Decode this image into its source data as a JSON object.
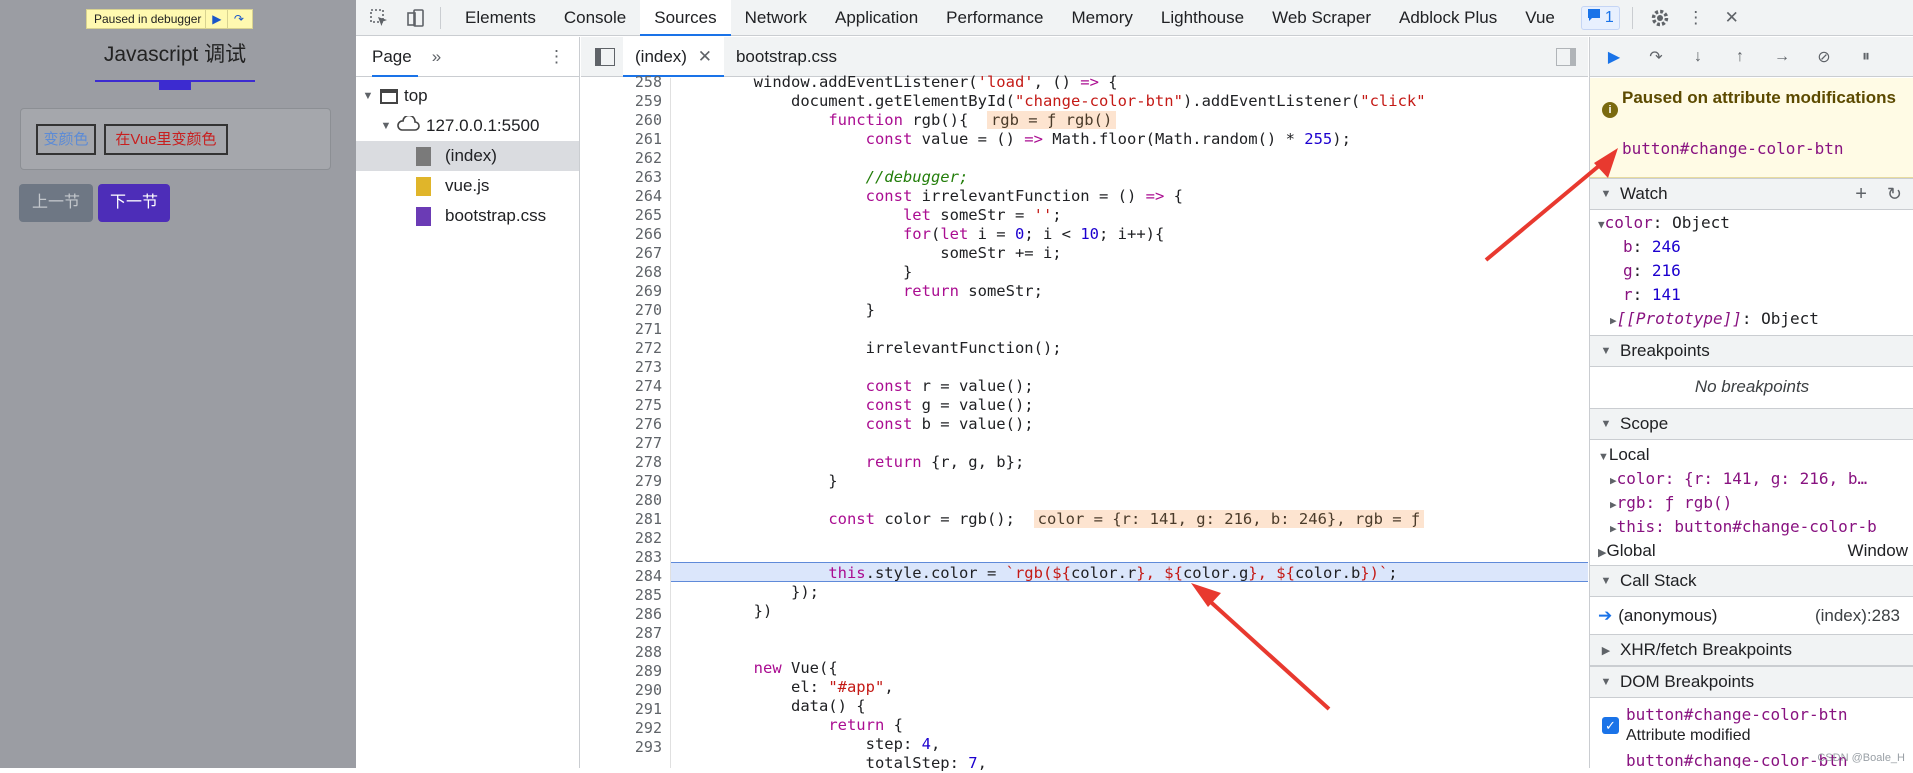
{
  "page": {
    "paused_label": "Paused in debugger",
    "title": "Javascript 调试",
    "btn_change_color": "变颜色",
    "btn_vue_change_color": "在Vue里变颜色",
    "prev_label": "上一节",
    "next_label": "下一节"
  },
  "toolbar": {
    "tabs": [
      "Elements",
      "Console",
      "Sources",
      "Network",
      "Application",
      "Performance",
      "Memory",
      "Lighthouse",
      "Web Scraper",
      "Adblock Plus",
      "Vue"
    ],
    "active_tab": "Sources",
    "issues_count": "1"
  },
  "navigator": {
    "tab": "Page",
    "top": "top",
    "host": "127.0.0.1:5500",
    "files": [
      "(index)",
      "vue.js",
      "bootstrap.css"
    ],
    "file_colors": [
      "#7a7a7a",
      "#e0b52a",
      "#6b3bb5"
    ]
  },
  "editor": {
    "tabs": [
      "(index)",
      "bootstrap.css"
    ],
    "line_numbers": [
      "258",
      "259",
      "260",
      "261",
      "262",
      "263",
      "264",
      "265",
      "266",
      "267",
      "268",
      "269",
      "270",
      "271",
      "272",
      "273",
      "274",
      "275",
      "276",
      "277",
      "278",
      "279",
      "280",
      "281",
      "282",
      "283",
      "284",
      "285",
      "286",
      "287",
      "288",
      "289",
      "290",
      "291",
      "292",
      "293"
    ],
    "inline_values": {
      "l260": "rgb = ƒ rgb()",
      "l281": "color = {r: 141, g: 216, b: 246}, rgb = ƒ"
    }
  },
  "sidebar": {
    "paused_title": "Paused on attribute modifications",
    "paused_target": "button#change-color-btn",
    "watch_title": "Watch",
    "watch": {
      "color_label": "color",
      "color_type": "Object",
      "b": "246",
      "g": "216",
      "r": "141",
      "proto_label": "[[Prototype]]",
      "proto_type": "Object"
    },
    "breakpoints_title": "Breakpoints",
    "no_breakpoints": "No breakpoints",
    "scope_title": "Scope",
    "local_title": "Local",
    "scope_color": "color: {r: 141, g: 216, b…",
    "scope_rgb": "rgb: ƒ rgb()",
    "scope_this": "this: button#change-color-b",
    "global_title": "Global",
    "global_value": "Window",
    "callstack_title": "Call Stack",
    "callstack_fn": "(anonymous)",
    "callstack_loc": "(index):283",
    "xhr_title": "XHR/fetch Breakpoints",
    "dom_title": "DOM Breakpoints",
    "dom_bp_target": "button#change-color-btn",
    "dom_bp_type": "Attribute modified",
    "dom_bp_target2": "button#change-color-btn",
    "watermark": "CSDN @Boale_H"
  }
}
